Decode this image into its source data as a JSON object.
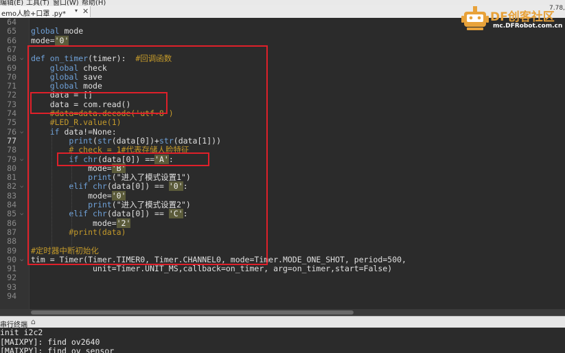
{
  "menubar": {
    "items": [
      "编辑(E)",
      "工具(T)",
      "窗口(W)",
      "帮助(H)"
    ]
  },
  "tab": {
    "title": "emo人脸+口罩 .py*",
    "dropdown": "▾",
    "close": "✕"
  },
  "version_fragment": "7.78,",
  "logo": {
    "brand": "DF创客社区",
    "url": "mc.DFRobot.com.cn"
  },
  "editor": {
    "current_line": "77",
    "lines": [
      {
        "n": "64",
        "fold": false
      },
      {
        "n": "65",
        "fold": false
      },
      {
        "n": "66",
        "fold": false
      },
      {
        "n": "67",
        "fold": false
      },
      {
        "n": "68",
        "fold": true
      },
      {
        "n": "69",
        "fold": false
      },
      {
        "n": "70",
        "fold": false
      },
      {
        "n": "71",
        "fold": false
      },
      {
        "n": "72",
        "fold": false
      },
      {
        "n": "73",
        "fold": false
      },
      {
        "n": "74",
        "fold": false
      },
      {
        "n": "75",
        "fold": false
      },
      {
        "n": "76",
        "fold": true
      },
      {
        "n": "77",
        "fold": false
      },
      {
        "n": "78",
        "fold": false
      },
      {
        "n": "79",
        "fold": true
      },
      {
        "n": "80",
        "fold": false
      },
      {
        "n": "81",
        "fold": false
      },
      {
        "n": "82",
        "fold": true
      },
      {
        "n": "83",
        "fold": false
      },
      {
        "n": "84",
        "fold": false
      },
      {
        "n": "85",
        "fold": true
      },
      {
        "n": "86",
        "fold": false
      },
      {
        "n": "87",
        "fold": false
      },
      {
        "n": "88",
        "fold": false
      },
      {
        "n": "89",
        "fold": false
      },
      {
        "n": "90",
        "fold": true
      },
      {
        "n": "91",
        "fold": false
      },
      {
        "n": "92",
        "fold": false
      },
      {
        "n": "93",
        "fold": false
      },
      {
        "n": "94",
        "fold": false
      }
    ],
    "code": [
      [],
      [
        {
          "t": "global",
          "c": "kw"
        },
        {
          "t": " mode",
          "c": "sp"
        }
      ],
      [
        {
          "t": "mode=",
          "c": "sp"
        },
        {
          "t": "'0'",
          "c": "str hl"
        }
      ],
      [],
      [
        {
          "t": "def",
          "c": "kw"
        },
        {
          "t": " ",
          "c": "sp"
        },
        {
          "t": "on_timer",
          "c": "kw"
        },
        {
          "t": "(timer):  ",
          "c": "sp"
        },
        {
          "t": "#回调函数",
          "c": "cm"
        }
      ],
      [
        {
          "t": "    ",
          "c": "sp"
        },
        {
          "t": "global",
          "c": "kw"
        },
        {
          "t": " check",
          "c": "sp"
        }
      ],
      [
        {
          "t": "    ",
          "c": "sp"
        },
        {
          "t": "global",
          "c": "kw"
        },
        {
          "t": " save",
          "c": "sp"
        }
      ],
      [
        {
          "t": "    ",
          "c": "sp"
        },
        {
          "t": "global",
          "c": "kw"
        },
        {
          "t": " mode",
          "c": "sp"
        }
      ],
      [
        {
          "t": "    data = []",
          "c": "sp"
        }
      ],
      [
        {
          "t": "    data = com.read()",
          "c": "sp"
        }
      ],
      [
        {
          "t": "    #data=data.decode('utf-8')",
          "c": "cm"
        }
      ],
      [
        {
          "t": "    #LED_R.value(1)",
          "c": "cm"
        }
      ],
      [
        {
          "t": "    ",
          "c": "sp"
        },
        {
          "t": "if",
          "c": "kw"
        },
        {
          "t": " data!=None:",
          "c": "sp"
        }
      ],
      [
        {
          "t": "        ",
          "c": "sp"
        },
        {
          "t": "print",
          "c": "kw"
        },
        {
          "t": "(",
          "c": "sp"
        },
        {
          "t": "str",
          "c": "kw"
        },
        {
          "t": "(data[0])+",
          "c": "sp"
        },
        {
          "t": "str",
          "c": "kw"
        },
        {
          "t": "(data[1]))",
          "c": "sp"
        }
      ],
      [
        {
          "t": "        # check = 1#代表存储人脸特征",
          "c": "cm"
        }
      ],
      [
        {
          "t": "        ",
          "c": "sp"
        },
        {
          "t": "if",
          "c": "kw"
        },
        {
          "t": " ",
          "c": "sp"
        },
        {
          "t": "chr",
          "c": "kw"
        },
        {
          "t": "(data[0]) ==",
          "c": "sp"
        },
        {
          "t": "'A'",
          "c": "str hl"
        },
        {
          "t": ":",
          "c": "sp"
        }
      ],
      [
        {
          "t": "            mode=",
          "c": "sp"
        },
        {
          "t": "'B'",
          "c": "str hl"
        }
      ],
      [
        {
          "t": "            ",
          "c": "sp"
        },
        {
          "t": "print",
          "c": "kw"
        },
        {
          "t": "(\"进入了模式设置1\")",
          "c": "sp"
        }
      ],
      [
        {
          "t": "        ",
          "c": "sp"
        },
        {
          "t": "elif",
          "c": "kw"
        },
        {
          "t": " ",
          "c": "sp"
        },
        {
          "t": "chr",
          "c": "kw"
        },
        {
          "t": "(data[0]) == ",
          "c": "sp"
        },
        {
          "t": "'0'",
          "c": "str hl"
        },
        {
          "t": ":",
          "c": "sp"
        }
      ],
      [
        {
          "t": "            mode=",
          "c": "sp"
        },
        {
          "t": "'0'",
          "c": "str hl"
        }
      ],
      [
        {
          "t": "            ",
          "c": "sp"
        },
        {
          "t": "print",
          "c": "kw"
        },
        {
          "t": "(\"进入了模式设置2\")",
          "c": "sp"
        }
      ],
      [
        {
          "t": "        ",
          "c": "sp"
        },
        {
          "t": "elif",
          "c": "kw"
        },
        {
          "t": " ",
          "c": "sp"
        },
        {
          "t": "chr",
          "c": "kw"
        },
        {
          "t": "(data[0]) == ",
          "c": "sp"
        },
        {
          "t": "'C'",
          "c": "str hl"
        },
        {
          "t": ":",
          "c": "sp"
        }
      ],
      [
        {
          "t": "             mode=",
          "c": "sp"
        },
        {
          "t": "'2'",
          "c": "str hl"
        }
      ],
      [
        {
          "t": "        #print(data)",
          "c": "cm"
        }
      ],
      [],
      [
        {
          "t": "#定时器中断初始化",
          "c": "cm"
        }
      ],
      [
        {
          "t": "tim = Timer(Timer.TIMER0, Timer.CHANNEL0, mode=Timer.MODE_ONE_SHOT, period=500,",
          "c": "sp"
        }
      ],
      [
        {
          "t": "             unit=Timer.UNIT_MS,callback=on_timer, arg=on_timer,start=False)",
          "c": "sp"
        }
      ],
      [],
      [],
      []
    ]
  },
  "terminal": {
    "title": "串行终端",
    "clear_icon": "⌂",
    "lines": [
      "init i2c2",
      "[MAIXPY]: find ov2640",
      "[MAIXPY]: find ov_sensor"
    ]
  },
  "colors": {
    "annotation": "#e0202a",
    "logo_orange": "#e8a23a",
    "keyword": "#6fa1d8",
    "comment": "#c49a2b"
  }
}
